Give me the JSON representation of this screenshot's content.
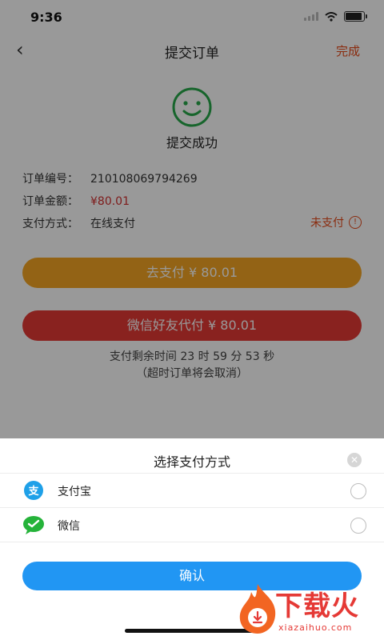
{
  "status_bar": {
    "time": "9:36"
  },
  "nav": {
    "title": "提交订单",
    "done": "完成"
  },
  "success": {
    "text": "提交成功"
  },
  "order": {
    "number_label": "订单编号：",
    "number": "210108069794269",
    "amount_label": "订单金额：",
    "amount": "¥80.01",
    "method_label": "支付方式：",
    "method": "在线支付",
    "status": "未支付"
  },
  "buttons": {
    "pay": "去支付 ¥ 80.01",
    "friend_pay": "微信好友代付 ¥ 80.01"
  },
  "countdown": {
    "line1": "支付剩余时间 23 时 59 分 53 秒",
    "line2": "（超时订单将会取消）"
  },
  "sheet": {
    "title": "选择支付方式",
    "options": [
      {
        "label": "支付宝",
        "icon": "alipay-icon",
        "selected": false
      },
      {
        "label": "微信",
        "icon": "wechat-icon",
        "selected": false
      }
    ],
    "confirm": "确认"
  },
  "watermark": {
    "text": "下载火",
    "domain": "xiazaihuo.com"
  },
  "colors": {
    "accent_orange": "#f5a623",
    "accent_red": "#e53935",
    "confirm_blue": "#2196f3",
    "success_green": "#27a84a"
  }
}
